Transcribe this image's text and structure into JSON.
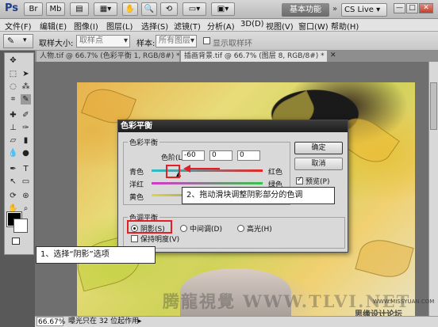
{
  "app": {
    "logo": "Ps",
    "workspace_button": "基本功能",
    "cs_live": "CS Live",
    "window_buttons": [
      "—",
      "□",
      "✕"
    ]
  },
  "menu": [
    "文件(F)",
    "编辑(E)",
    "图像(I)",
    "图层(L)",
    "选择(S)",
    "滤镜(T)",
    "分析(A)",
    "3D(D)",
    "视图(V)",
    "窗口(W)",
    "帮助(H)"
  ],
  "options": {
    "sample_size_label": "取样大小:",
    "sample_size_value": "取样点",
    "sample_label": "样本:",
    "sample_value": "所有图层",
    "show_ring_label": "显示取样环"
  },
  "tabs": [
    {
      "label": "人物.tif @ 66.7% (色彩平衡 1, RGB/8#) *"
    },
    {
      "label": "插画背景.tif @ 66.7% (图层 8, RGB/8#) *"
    }
  ],
  "dialog": {
    "title": "色彩平衡",
    "balance_group": "色彩平衡",
    "levels_label": "色阶(L):",
    "levels": [
      "-60",
      "0",
      "0"
    ],
    "sliders": [
      {
        "left": "青色",
        "right": "红色",
        "position": 0.25
      },
      {
        "left": "洋红",
        "right": "绿色",
        "position": 0.5
      },
      {
        "left": "黄色",
        "right": "蓝色",
        "position": 0.5
      }
    ],
    "ok": "确定",
    "cancel": "取消",
    "preview": "预览(P)",
    "tone_group": "色调平衡",
    "tones": [
      "阴影(S)",
      "中间调(D)",
      "高光(H)"
    ],
    "preserve": "保持明度(V)"
  },
  "annotations": {
    "step1": "1、选择“阴影”选项",
    "step2": "2、拖动滑块调整阴影部分的色调"
  },
  "status": {
    "zoom": "66.67%",
    "info": "曝光只在 32 位起作用"
  },
  "watermarks": {
    "main": "腾龍視覺 WWW.TLVI.NET",
    "site_cn": "思缘设计论坛",
    "site_url": "WWW.MISSYUAN.COM"
  }
}
